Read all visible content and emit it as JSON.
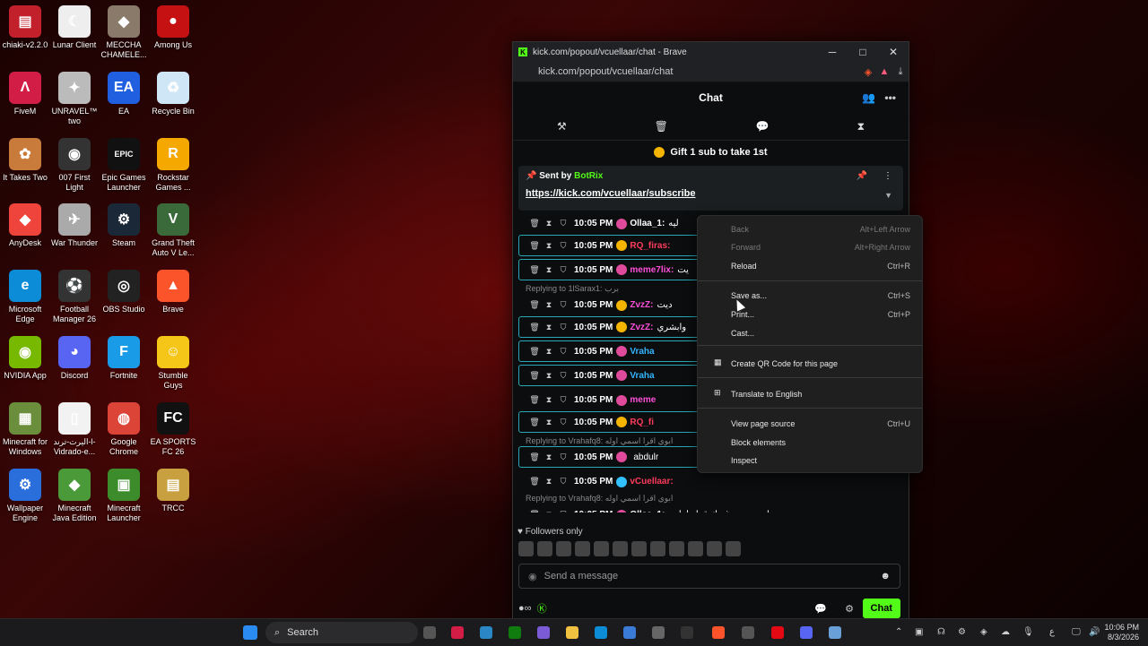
{
  "desktop": {
    "icons": [
      {
        "label": "chiaki-v2.2.0",
        "color": "#c2202a",
        "glyph": "▤"
      },
      {
        "label": "Lunar Client",
        "color": "#eeeeee",
        "glyph": "☾"
      },
      {
        "label": "MECCHA CHAMELE...",
        "color": "#8a7a6a",
        "glyph": "◆"
      },
      {
        "label": "Among Us",
        "color": "#c51111",
        "glyph": "●"
      },
      {
        "label": "FiveM",
        "color": "#d21e46",
        "glyph": "Λ"
      },
      {
        "label": "UNRAVEL™ two",
        "color": "#bbbbbb",
        "glyph": "✦"
      },
      {
        "label": "EA",
        "color": "#1f5fe0",
        "glyph": "EA"
      },
      {
        "label": "Recycle Bin",
        "color": "#cfe6f7",
        "glyph": "♻"
      },
      {
        "label": "It Takes Two",
        "color": "#c87b3a",
        "glyph": "✿"
      },
      {
        "label": "007 First Light",
        "color": "#333333",
        "glyph": "◉"
      },
      {
        "label": "Epic Games Launcher",
        "color": "#111111",
        "glyph": "EPIC"
      },
      {
        "label": "Rockstar Games ...",
        "color": "#f4a800",
        "glyph": "R"
      },
      {
        "label": "AnyDesk",
        "color": "#ef443b",
        "glyph": "◆"
      },
      {
        "label": "War Thunder",
        "color": "#aaaaaa",
        "glyph": "✈"
      },
      {
        "label": "Steam",
        "color": "#1b2838",
        "glyph": "⚙"
      },
      {
        "label": "Grand Theft Auto V Le...",
        "color": "#3a6a3a",
        "glyph": "V"
      },
      {
        "label": "Microsoft Edge",
        "color": "#0c8bd6",
        "glyph": "e"
      },
      {
        "label": "Football Manager 26",
        "color": "#333333",
        "glyph": "⚽"
      },
      {
        "label": "OBS Studio",
        "color": "#222222",
        "glyph": "◎"
      },
      {
        "label": "Brave",
        "color": "#fb542b",
        "glyph": "▲"
      },
      {
        "label": "NVIDIA App",
        "color": "#76b900",
        "glyph": "◉"
      },
      {
        "label": "Discord",
        "color": "#5865f2",
        "glyph": "◕"
      },
      {
        "label": "Fortnite",
        "color": "#1a9be8",
        "glyph": "F"
      },
      {
        "label": "Stumble Guys",
        "color": "#f5c518",
        "glyph": "☺"
      },
      {
        "label": "Minecraft for Windows",
        "color": "#6b8e3d",
        "glyph": "▦"
      },
      {
        "label": "اليرت-ترند-l- Vidrado-e...",
        "color": "#f2f2f2",
        "glyph": "▯"
      },
      {
        "label": "Google Chrome",
        "color": "#db4437",
        "glyph": "◍"
      },
      {
        "label": "EA SPORTS FC 26",
        "color": "#111111",
        "glyph": "FC"
      },
      {
        "label": "Wallpaper Engine",
        "color": "#2a6edb",
        "glyph": "⚙"
      },
      {
        "label": "Minecraft Java Edition",
        "color": "#4a9a3a",
        "glyph": "◆"
      },
      {
        "label": "Minecraft Launcher",
        "color": "#3c8c2c",
        "glyph": "▣"
      },
      {
        "label": "TRCC",
        "color": "#c8a040",
        "glyph": "▤"
      }
    ]
  },
  "window": {
    "title": "kick.com/popout/vcuellaar/chat - Brave",
    "url": "kick.com/popout/vcuellaar/chat",
    "minimize": "─",
    "maximize": "□",
    "close": "✕"
  },
  "chat": {
    "header": "Chat",
    "gift_banner": "Gift 1 sub to take 1st",
    "pinned": {
      "sent_by_label": "Sent by",
      "author": "BotRix",
      "link": "https://kick.com/vcuellaar/subscribe"
    },
    "messages": [
      {
        "time": "10:05 PM",
        "user": "Ollaa_1:",
        "text": "ليه",
        "user_color": "#ffffff",
        "badge": "#e04a9a",
        "outlined": false,
        "reply": ""
      },
      {
        "time": "10:05 PM",
        "user": "RQ_firas:",
        "text": "",
        "user_color": "#ff3b5c",
        "badge": "#f5b400",
        "outlined": true,
        "reply": ""
      },
      {
        "time": "10:05 PM",
        "user": "meme7lix:",
        "text": "يت",
        "user_color": "#ff4fd8",
        "badge": "#e04a9a",
        "outlined": true,
        "reply": ""
      },
      {
        "time": "10:05 PM",
        "user": "ZvzZ:",
        "text": "ديت",
        "user_color": "#ff4fd8",
        "badge": "#f5b400",
        "outlined": false,
        "reply": "Replying to 1lSarax1: برب"
      },
      {
        "time": "10:05 PM",
        "user": "ZvzZ:",
        "text": "وابشري",
        "user_color": "#ff4fd8",
        "badge": "#f5b400",
        "outlined": true,
        "reply": ""
      },
      {
        "time": "10:05 PM",
        "user": "Vraha",
        "text": "",
        "user_color": "#33b5ff",
        "badge": "#e04a9a",
        "outlined": true,
        "reply": ""
      },
      {
        "time": "10:05 PM",
        "user": "Vraha",
        "text": "",
        "user_color": "#33b5ff",
        "badge": "#e04a9a",
        "outlined": true,
        "reply": ""
      },
      {
        "time": "10:05 PM",
        "user": "meme",
        "text": "",
        "user_color": "#ff4fd8",
        "badge": "#e04a9a",
        "outlined": false,
        "reply": ""
      },
      {
        "time": "10:05 PM",
        "user": "RQ_fi",
        "text": "",
        "user_color": "#ff3b5c",
        "badge": "#f5b400",
        "outlined": true,
        "reply": ""
      },
      {
        "time": "10:05 PM",
        "user": "",
        "text": "abdulr",
        "user_color": "#33b5ff",
        "badge": "#e04a9a",
        "outlined": true,
        "reply": "Replying to Vrahafq8: ابوي اقرا اسمي اوله"
      },
      {
        "time": "10:05 PM",
        "user": "vCuellaar:",
        "text": "",
        "user_color": "#ff3b5c",
        "badge": "#33c0ff",
        "outlined": false,
        "reply": ""
      },
      {
        "time": "10:05 PM",
        "user": "Ollaa_1:",
        "text": "احسن من غيرك قراه لوليي",
        "user_color": "#ffffff",
        "badge": "#e04a9a",
        "outlined": false,
        "reply": "Replying to Vrahafq8: ابوي اقرا اسمي اوله"
      }
    ],
    "followers_only": "Followers only",
    "input_placeholder": "Send a message",
    "send_label": "Chat"
  },
  "context_menu": {
    "items": [
      {
        "label": "Back",
        "shortcut": "Alt+Left Arrow",
        "disabled": true
      },
      {
        "label": "Forward",
        "shortcut": "Alt+Right Arrow",
        "disabled": true
      },
      {
        "label": "Reload",
        "shortcut": "Ctrl+R",
        "disabled": false
      },
      {
        "label": "Save as...",
        "shortcut": "Ctrl+S",
        "disabled": false
      },
      {
        "label": "Print...",
        "shortcut": "Ctrl+P",
        "disabled": false
      },
      {
        "label": "Cast...",
        "shortcut": "",
        "disabled": false
      },
      {
        "label": "Create QR Code for this page",
        "shortcut": "",
        "disabled": false
      },
      {
        "label": "Translate to English",
        "shortcut": "",
        "disabled": false
      },
      {
        "label": "View page source",
        "shortcut": "Ctrl+U",
        "disabled": false
      },
      {
        "label": "Block elements",
        "shortcut": "",
        "disabled": false
      },
      {
        "label": "Inspect",
        "shortcut": "",
        "disabled": false
      }
    ]
  },
  "taskbar": {
    "search_label": "Search",
    "lang": "ع",
    "time": "10:06 PM",
    "date": "8/3/2026"
  }
}
